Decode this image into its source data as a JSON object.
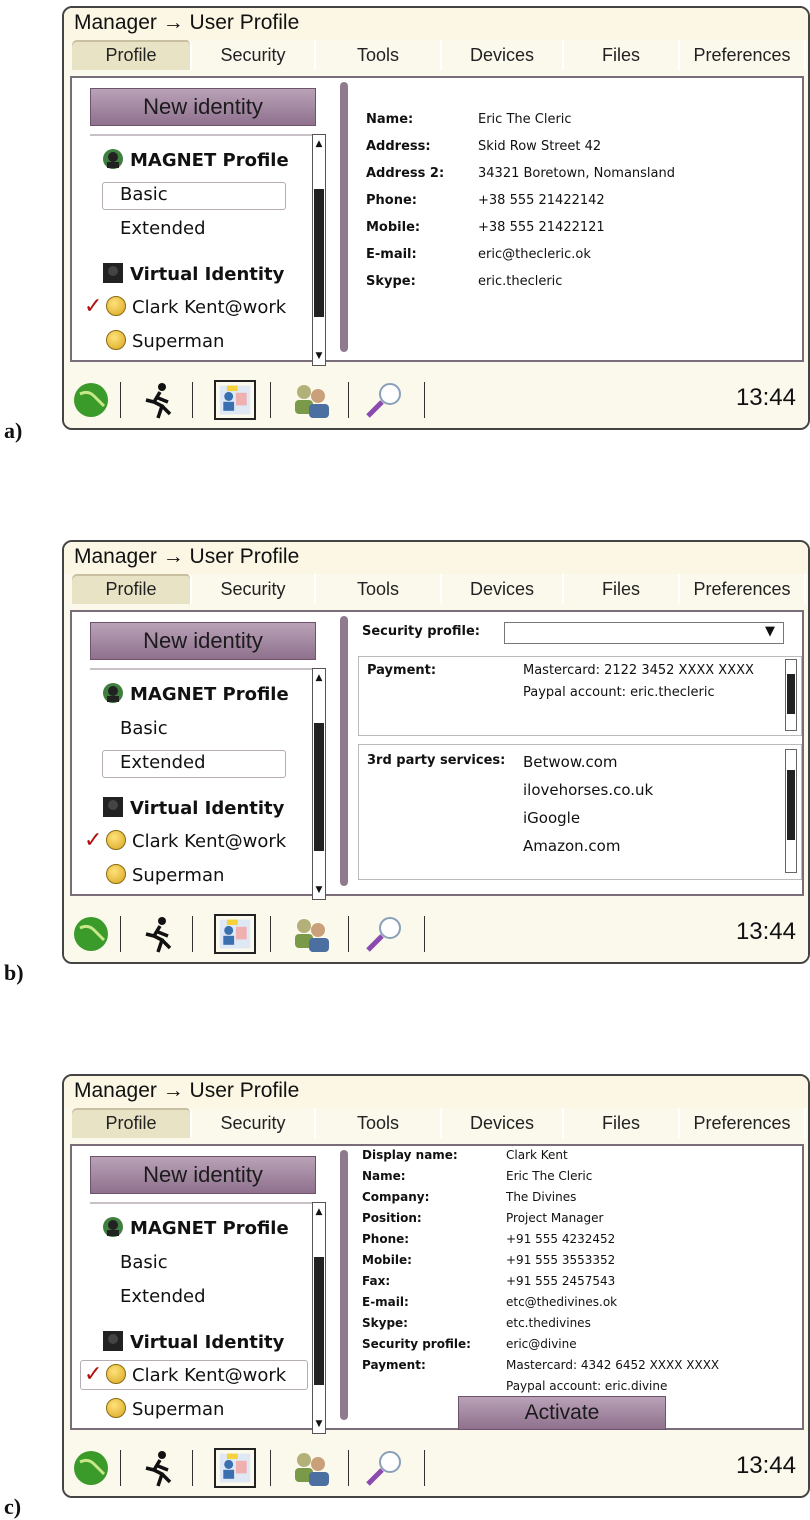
{
  "figure_labels": [
    "a)",
    "b)",
    "c)"
  ],
  "window_title": "Manager → User Profile",
  "tabs": [
    "Profile",
    "Security",
    "Tools",
    "Devices",
    "Files",
    "Preferences"
  ],
  "left_panel": {
    "new_identity": "New identity",
    "magnet_profile": "MAGNET Profile",
    "basic": "Basic",
    "extended": "Extended",
    "virtual_identity": "Virtual Identity",
    "clark": "Clark Kent@work",
    "superman": "Superman"
  },
  "clock": "13:44",
  "panel_a": {
    "labels": [
      "Name:",
      "Address:",
      "Address 2:",
      "Phone:",
      "Mobile:",
      "E-mail:",
      "Skype:"
    ],
    "values": [
      "Eric The Cleric",
      "Skid Row Street 42",
      "34321 Boretown, Nomansland",
      "+38 555 21422142",
      "+38 555 21422121",
      "eric@thecleric.ok",
      "eric.thecleric"
    ]
  },
  "panel_b": {
    "security_profile_label": "Security profile:",
    "payment_label": "Payment:",
    "payment_values": [
      "Mastercard: 2122 3452 XXXX XXXX",
      "Paypal account: eric.thecleric"
    ],
    "third_party_label": "3rd party services:",
    "third_party_values": [
      "Betwow.com",
      "ilovehorses.co.uk",
      "iGoogle",
      "Amazon.com"
    ]
  },
  "panel_c": {
    "labels": [
      "Display name:",
      "Name:",
      "Company:",
      "Position:",
      "Phone:",
      "Mobile:",
      "Fax:",
      "E-mail:",
      "Skype:",
      "Security profile:",
      "Payment:"
    ],
    "values": [
      "Clark Kent",
      "Eric The Cleric",
      "The Divines",
      "Project Manager",
      "+91 555 4232452",
      "+91 555 3553352",
      "+91 555 2457543",
      "etc@thedivines.ok",
      "etc.thedivines",
      "eric@divine",
      "Mastercard: 4342 6452 XXXX XXXX",
      "Paypal account: eric.divine"
    ],
    "activate": "Activate"
  }
}
